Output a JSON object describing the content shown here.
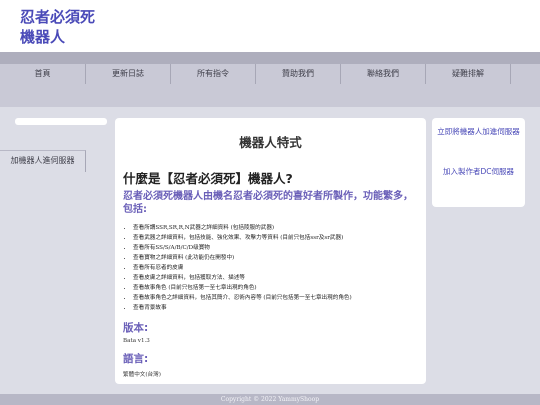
{
  "site": {
    "title_line1": "忍者必須死",
    "title_line2": "機器人"
  },
  "nav": {
    "items": [
      "首頁",
      "更新日誌",
      "所有指令",
      "贊助我們",
      "聯絡我們",
      "疑難排解"
    ],
    "row2": "加機器人進伺服器"
  },
  "main": {
    "title": "機器人特式",
    "heading": "什麼是【忍者必須死】機器人?",
    "intro": "忍者必須死機器人由機名忍者必須死的喜好者所製作，功能繁多，包括:",
    "features": [
      "查看所謂SSR,SR,R,N武器之詳細資料 (包括陵服的武器)",
      "查看武器之詳細資料，包括技能、強化效果、攻擊力等資料 (目前只包括ssr及sr武器)",
      "查看所有SS/S/A/B/C/D级寶物",
      "查看寶物之詳細資料 (此功能仍在開發中)",
      "查看所有忍者的皮膚",
      "查看皮膚之詳細資料，包括獲取方法、描述等",
      "查看故事角色 (目前只包括第一至七章出現的角色)",
      "查看故事角色之詳細資料，包括其簡介、忍術內容等 (目前只包括第一至七章出現的角色)",
      "查看背景故事"
    ],
    "version_heading": "版本:",
    "version_value": "Bata v1.3",
    "language_heading": "語言:",
    "language_value": "繁體中文(台灣)"
  },
  "sidebar": {
    "link1": "立即將機器人加進伺服器",
    "link2": "加入製作者DC伺服器"
  },
  "footer": {
    "text": "Copyright © 2022 YammyShoop"
  }
}
